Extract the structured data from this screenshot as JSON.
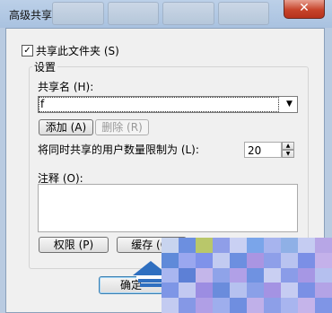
{
  "window": {
    "title": "高级共享",
    "close_label": "✕"
  },
  "share_checkbox": {
    "label": "共享此文件夹 (S)",
    "checked": true,
    "check_mark": "✓"
  },
  "settings": {
    "legend": "设置",
    "share_name_label": "共享名 (H):",
    "share_name_value": "f",
    "add_button": "添加 (A)",
    "remove_button": "删除 (R)",
    "limit_label": "将同时共享的用户数量限制为 (L):",
    "limit_value": "20",
    "comment_label": "注释 (O):",
    "comment_value": "",
    "permissions_button": "权限 (P)",
    "cache_button": "缓存 (C)"
  },
  "footer": {
    "ok_button": "确定"
  },
  "colors": {
    "accent_close": "#c7442b",
    "watermark_blue": "#2f6fc0"
  },
  "icons": {
    "combo_arrow": "▼",
    "spin_up": "▲",
    "spin_down": "▼"
  }
}
